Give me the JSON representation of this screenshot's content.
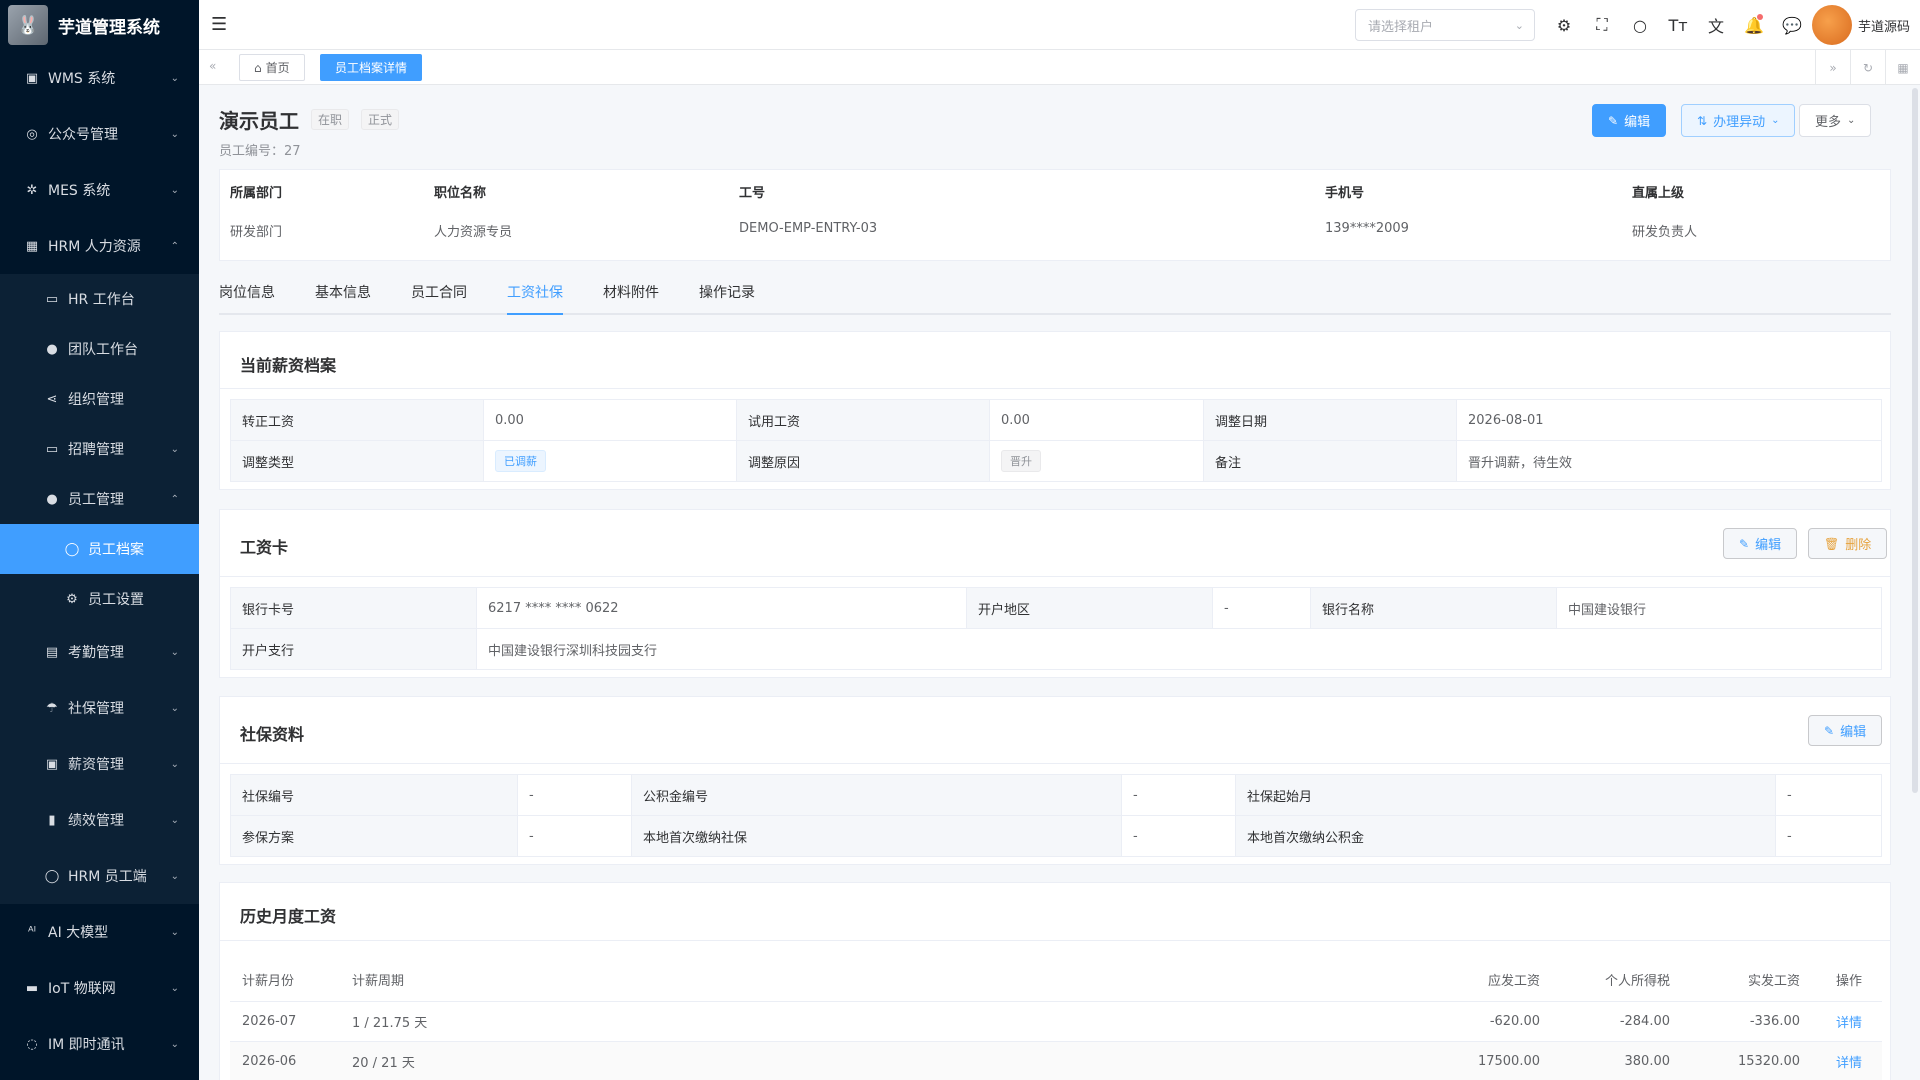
{
  "app": {
    "title": "芋道管理系统"
  },
  "sidebar": {
    "items": [
      {
        "label": "WMS 系统",
        "icon": "box-icon"
      },
      {
        "label": "公众号管理",
        "icon": "compass-icon"
      },
      {
        "label": "MES 系统",
        "icon": "chip-icon"
      },
      {
        "label": "HRM 人力资源",
        "icon": "building-icon"
      }
    ],
    "hrm_sub": [
      {
        "label": "HR 工作台"
      },
      {
        "label": "团队工作台"
      },
      {
        "label": "组织管理"
      },
      {
        "label": "招聘管理"
      },
      {
        "label": "员工管理"
      }
    ],
    "emp_sub": [
      {
        "label": "员工档案"
      },
      {
        "label": "员工设置"
      }
    ],
    "hrm_sub2": [
      {
        "label": "考勤管理"
      },
      {
        "label": "社保管理"
      },
      {
        "label": "薪资管理"
      },
      {
        "label": "绩效管理"
      },
      {
        "label": "HRM 员工端"
      }
    ],
    "bottom": [
      {
        "label": "AI 大模型"
      },
      {
        "label": "IoT 物联网"
      },
      {
        "label": "IM 即时通讯"
      }
    ]
  },
  "header": {
    "tenant_placeholder": "请选择租户",
    "user_name": "芋道源码"
  },
  "tags": {
    "home": "首页",
    "current": "员工档案详情"
  },
  "employee": {
    "name": "演示员工",
    "status": "在职",
    "type": "正式",
    "no_label": "员工编号：",
    "no": "27"
  },
  "actions": {
    "edit": "编辑",
    "change": "办理异动",
    "more": "更多"
  },
  "info": {
    "dept_label": "所属部门",
    "dept": "研发部门",
    "position_label": "职位名称",
    "position": "人力资源专员",
    "code_label": "工号",
    "code": "DEMO-EMP-ENTRY-03",
    "phone_label": "手机号",
    "phone": "139****2009",
    "leader_label": "直属上级",
    "leader": "研发负责人"
  },
  "tabs": [
    "岗位信息",
    "基本信息",
    "员工合同",
    "工资社保",
    "材料附件",
    "操作记录"
  ],
  "salary": {
    "title": "当前薪资档案",
    "regular_label": "转正工资",
    "regular": "0.00",
    "trial_label": "试用工资",
    "trial": "0.00",
    "date_label": "调整日期",
    "date": "2026-08-01",
    "type_label": "调整类型",
    "type": "已调薪",
    "reason_label": "调整原因",
    "reason": "晋升",
    "remark_label": "备注",
    "remark": "晋升调薪，待生效"
  },
  "card": {
    "title": "工资卡",
    "edit": "编辑",
    "delete": "删除",
    "no_label": "银行卡号",
    "no": "6217 **** **** 0622",
    "region_label": "开户地区",
    "region": "-",
    "bank_label": "银行名称",
    "bank": "中国建设银行",
    "branch_label": "开户支行",
    "branch": "中国建设银行深圳科技园支行"
  },
  "social": {
    "title": "社保资料",
    "edit": "编辑",
    "no_label": "社保编号",
    "no": "-",
    "fund_label": "公积金编号",
    "fund": "-",
    "start_label": "社保起始月",
    "start": "-",
    "plan_label": "参保方案",
    "plan": "-",
    "local_si_label": "本地首次缴纳社保",
    "local_si": "-",
    "local_fund_label": "本地首次缴纳公积金",
    "local_fund": "-"
  },
  "history": {
    "title": "历史月度工资",
    "columns": [
      "计薪月份",
      "计薪周期",
      "应发工资",
      "个人所得税",
      "实发工资",
      "操作"
    ],
    "rows": [
      {
        "month": "2026-07",
        "period": "1 / 21.75 天",
        "gross": "-620.00",
        "tax": "-284.00",
        "net": "-336.00",
        "op": "详情"
      },
      {
        "month": "2026-06",
        "period": "20 / 21 天",
        "gross": "17500.00",
        "tax": "380.00",
        "net": "15320.00",
        "op": "详情"
      }
    ]
  }
}
